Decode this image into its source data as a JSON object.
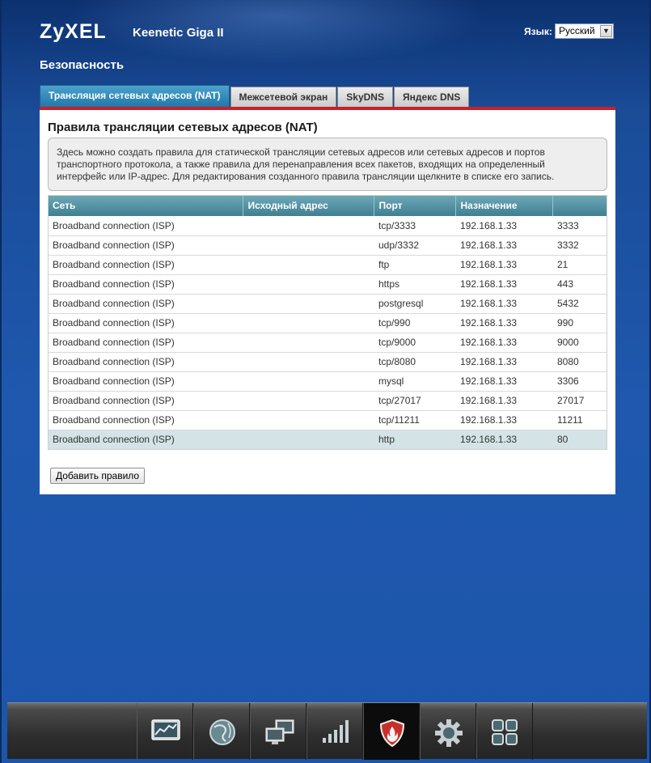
{
  "brand": {
    "logo": "ZyXEL",
    "model": "Keenetic Giga II"
  },
  "language": {
    "label": "Язык:",
    "selected": "Русский"
  },
  "section_title": "Безопасность",
  "tabs": [
    {
      "label": "Трансляция сетевых адресов (NAT)",
      "active": true
    },
    {
      "label": "Межсетевой экран",
      "active": false
    },
    {
      "label": "SkyDNS",
      "active": false
    },
    {
      "label": "Яндекс DNS",
      "active": false
    }
  ],
  "panel": {
    "title": "Правила трансляции сетевых адресов (NAT)",
    "info_lines": [
      "Здесь можно создать правила для статической трансляции сетевых адресов или сетевых адресов и портов",
      "транспортного протокола, а также правила для перенаправления всех пакетов, входящих на определенный",
      "интерфейс или IP-адрес. Для редактирования созданного правила трансляции щелкните в списке его запись."
    ]
  },
  "table": {
    "columns": [
      "Сеть",
      "Исходный адрес",
      "Порт",
      "Назначение",
      ""
    ],
    "rows": [
      {
        "network": "Broadband connection (ISP)",
        "source": "",
        "port": "tcp/3333",
        "dest_ip": "192.168.1.33",
        "dest_port": "3333"
      },
      {
        "network": "Broadband connection (ISP)",
        "source": "",
        "port": "udp/3332",
        "dest_ip": "192.168.1.33",
        "dest_port": "3332"
      },
      {
        "network": "Broadband connection (ISP)",
        "source": "",
        "port": "ftp",
        "dest_ip": "192.168.1.33",
        "dest_port": "21"
      },
      {
        "network": "Broadband connection (ISP)",
        "source": "",
        "port": "https",
        "dest_ip": "192.168.1.33",
        "dest_port": "443"
      },
      {
        "network": "Broadband connection (ISP)",
        "source": "",
        "port": "postgresql",
        "dest_ip": "192.168.1.33",
        "dest_port": "5432"
      },
      {
        "network": "Broadband connection (ISP)",
        "source": "",
        "port": "tcp/990",
        "dest_ip": "192.168.1.33",
        "dest_port": "990"
      },
      {
        "network": "Broadband connection (ISP)",
        "source": "",
        "port": "tcp/9000",
        "dest_ip": "192.168.1.33",
        "dest_port": "9000"
      },
      {
        "network": "Broadband connection (ISP)",
        "source": "",
        "port": "tcp/8080",
        "dest_ip": "192.168.1.33",
        "dest_port": "8080"
      },
      {
        "network": "Broadband connection (ISP)",
        "source": "",
        "port": "mysql",
        "dest_ip": "192.168.1.33",
        "dest_port": "3306"
      },
      {
        "network": "Broadband connection (ISP)",
        "source": "",
        "port": "tcp/27017",
        "dest_ip": "192.168.1.33",
        "dest_port": "27017"
      },
      {
        "network": "Broadband connection (ISP)",
        "source": "",
        "port": "tcp/11211",
        "dest_ip": "192.168.1.33",
        "dest_port": "11211"
      },
      {
        "network": "Broadband connection (ISP)",
        "source": "",
        "port": "http",
        "dest_ip": "192.168.1.33",
        "dest_port": "80",
        "selected": true
      }
    ]
  },
  "add_button": "Добавить правило",
  "footer_nav": [
    {
      "icon": "monitor-chart-icon",
      "active": false
    },
    {
      "icon": "globe-icon",
      "active": false
    },
    {
      "icon": "network-computers-icon",
      "active": false
    },
    {
      "icon": "signal-bars-icon",
      "active": false
    },
    {
      "icon": "security-shield-icon",
      "active": true
    },
    {
      "icon": "gear-icon",
      "active": false
    },
    {
      "icon": "apps-grid-icon",
      "active": false
    }
  ],
  "colors": {
    "background": "#1d4f9a",
    "active_tab": "#2a84b6",
    "accent_red": "#c8202a",
    "table_header": "#4f8ea0",
    "selected_row": "#d4e3e6"
  }
}
